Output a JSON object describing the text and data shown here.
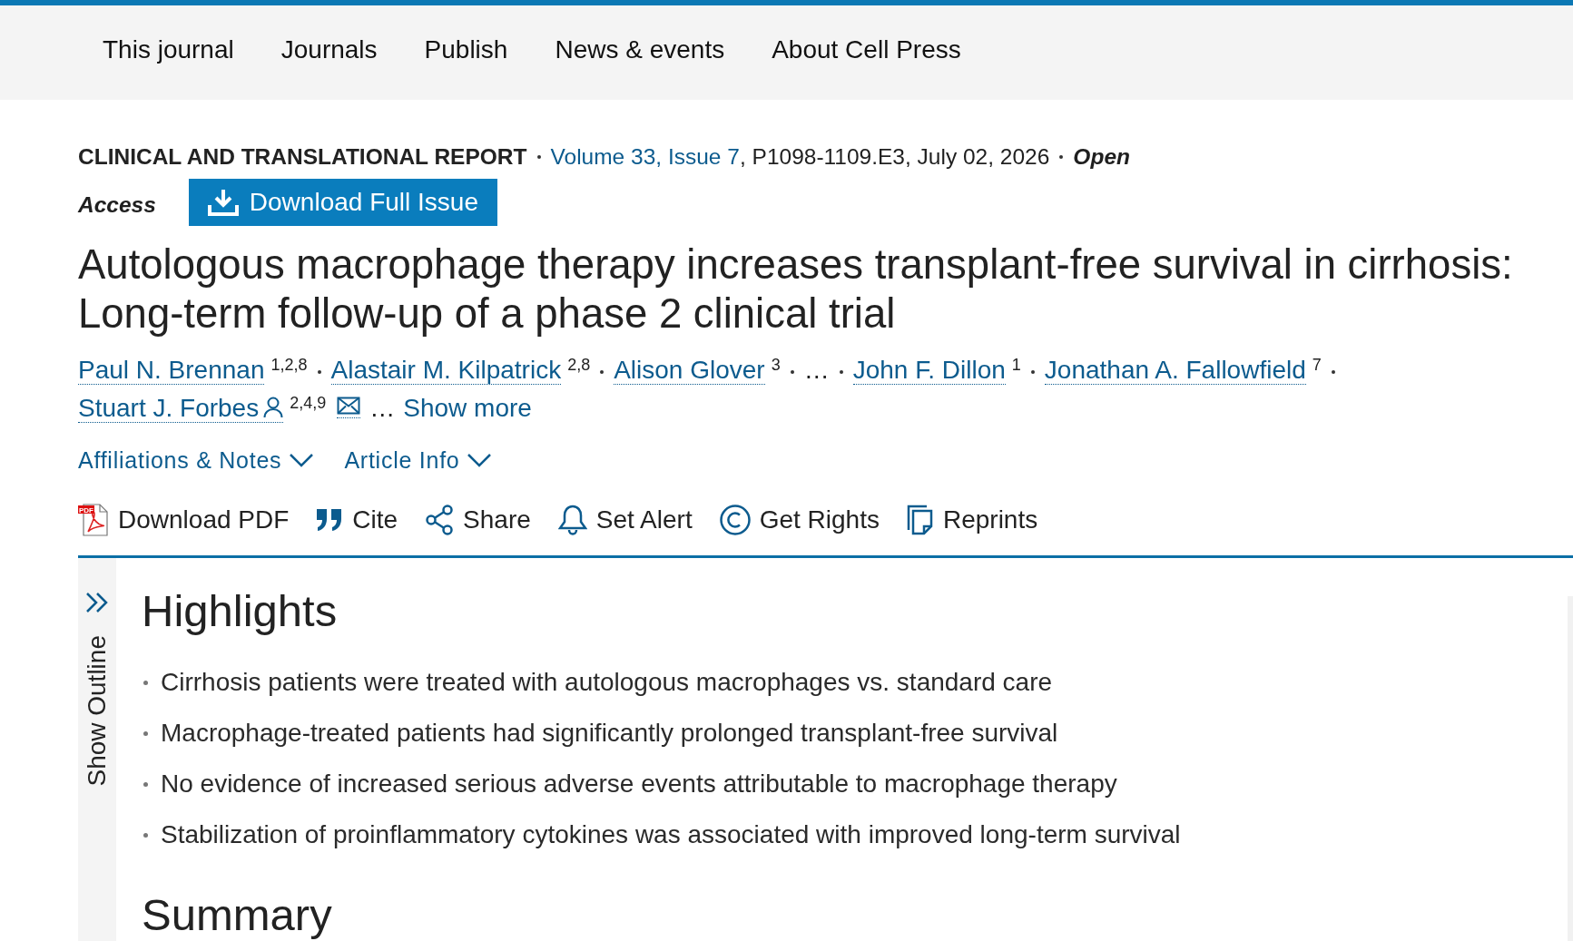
{
  "top_nav": {
    "items": [
      "This journal",
      "Journals",
      "Publish",
      "News & events",
      "About Cell Press"
    ]
  },
  "article_header": {
    "article_type": "CLINICAL AND TRANSLATIONAL REPORT",
    "issue_link": "Volume 33, Issue 7",
    "citation": ", P1098-1109.E3, July 02, 2026",
    "access_label": [
      "Open",
      "Access"
    ],
    "download_button": "Download Full Issue"
  },
  "title": "Autologous macrophage therapy increases transplant-free survival in cirrhosis: Long-term follow-up of a phase 2 clinical trial",
  "authors": [
    {
      "kind": "author",
      "name": "Paul N. Brennan",
      "affiliations": "1,2,8",
      "corresponding": false,
      "email": false
    },
    {
      "kind": "author",
      "name": "Alastair M. Kilpatrick",
      "affiliations": "2,8",
      "corresponding": false,
      "email": false
    },
    {
      "kind": "author",
      "name": "Alison Glover",
      "affiliations": "3",
      "corresponding": false,
      "email": false
    },
    {
      "kind": "ellipsis",
      "text": "…"
    },
    {
      "kind": "author",
      "name": "John F. Dillon",
      "affiliations": "1",
      "corresponding": false,
      "email": false
    },
    {
      "kind": "author",
      "name": "Jonathan A. Fallowfield",
      "affiliations": "7",
      "corresponding": false,
      "email": false
    },
    {
      "kind": "author",
      "name": "Stuart J. Forbes",
      "affiliations": "2,4,9",
      "corresponding": true,
      "email": true
    }
  ],
  "show_more": {
    "ellipsis": "…",
    "label": "Show more"
  },
  "info_toggles": [
    {
      "label": "Affiliations & Notes",
      "expanded": false
    },
    {
      "label": "Article Info",
      "expanded": false
    }
  ],
  "actions": [
    {
      "label": "Download PDF",
      "icon_text": "PDF"
    },
    {
      "label": "Cite"
    },
    {
      "label": "Share"
    },
    {
      "label": "Set Alert"
    },
    {
      "label": "Get Rights"
    },
    {
      "label": "Reprints"
    }
  ],
  "outline_toggle": {
    "label": "Show Outline",
    "expanded": false
  },
  "sections": [
    {
      "heading": "Highlights",
      "bullets": [
        "Cirrhosis patients were treated with autologous macrophages vs. standard care",
        "Macrophage-treated patients had significantly prolonged transplant-free survival",
        "No evidence of increased serious adverse events attributable to macrophage therapy",
        "Stabilization of proinflammatory cytokines was associated with improved long-term survival"
      ]
    },
    {
      "heading": "Summary"
    }
  ]
}
